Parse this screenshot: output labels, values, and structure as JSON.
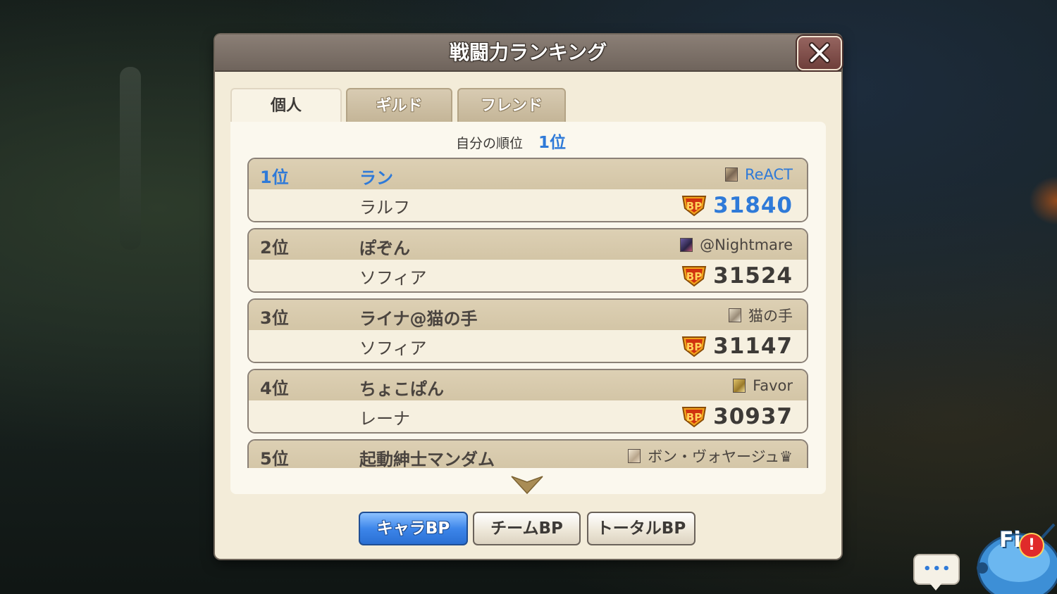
{
  "dialog": {
    "title": "戦闘力ランキング",
    "close_icon": "close-icon"
  },
  "tabs": [
    {
      "label": "個人",
      "active": true
    },
    {
      "label": "ギルド",
      "active": false
    },
    {
      "label": "フレンド",
      "active": false
    }
  ],
  "my_rank": {
    "label": "自分の順位",
    "value": "1位"
  },
  "rankings": [
    {
      "rank": "1位",
      "player": "ラン",
      "guild": "ReACT",
      "character": "ラルフ",
      "bp": "31840",
      "highlight": true
    },
    {
      "rank": "2位",
      "player": "ぽぞん",
      "guild": "@Nightmare",
      "character": "ソフィア",
      "bp": "31524",
      "highlight": false
    },
    {
      "rank": "3位",
      "player": "ライナ@猫の手",
      "guild": "猫の手",
      "character": "ソフィア",
      "bp": "31147",
      "highlight": false
    },
    {
      "rank": "4位",
      "player": "ちょこぱん",
      "guild": "Favor",
      "character": "レーナ",
      "bp": "30937",
      "highlight": false
    },
    {
      "rank": "5位",
      "player": "起動紳士マンダム",
      "guild": "ボン・ヴォヤージュ♛",
      "character": "",
      "bp": "",
      "highlight": false
    }
  ],
  "bp_icon_text": "BP",
  "sort_buttons": [
    {
      "label": "キャラBP",
      "active": true
    },
    {
      "label": "チームBP",
      "active": false
    },
    {
      "label": "トータルBP",
      "active": false
    }
  ],
  "overlay": {
    "chat_dots": "•••",
    "mascot_text": "Fi",
    "alert": "!"
  },
  "colors": {
    "accent": "#2f7ad8",
    "title_bar": "#6f645c",
    "panel": "#f3ecd9"
  }
}
